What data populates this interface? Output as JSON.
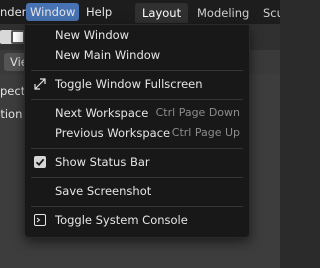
{
  "menubar": {
    "items": [
      "nder",
      "Window",
      "Help"
    ],
    "active": "Window"
  },
  "workspaces": {
    "tabs": [
      "Layout",
      "Modeling",
      "Scu"
    ],
    "active": "Layout"
  },
  "editor": {
    "view_label": "View",
    "viewport_labels": [
      "spect",
      "ction"
    ]
  },
  "window_menu": {
    "items": [
      {
        "label": "New Window",
        "shortcut": ""
      },
      {
        "label": "New Main Window",
        "shortcut": ""
      },
      {
        "label": "Toggle Window Fullscreen",
        "shortcut": "",
        "icon": "fullscreen-icon"
      },
      {
        "label": "Next Workspace",
        "shortcut": "Ctrl Page Down"
      },
      {
        "label": "Previous Workspace",
        "shortcut": "Ctrl Page Up"
      },
      {
        "label": "Show Status Bar",
        "shortcut": "",
        "icon": "checkbox-checked-icon",
        "checked": true
      },
      {
        "label": "Save Screenshot",
        "shortcut": ""
      },
      {
        "label": "Toggle System Console",
        "shortcut": "",
        "icon": "console-icon"
      }
    ]
  },
  "colors": {
    "accent": "#4772b3",
    "menu_bg": "#181818",
    "text": "#e6e6e6",
    "shortcut_text": "#8c8c8c"
  }
}
